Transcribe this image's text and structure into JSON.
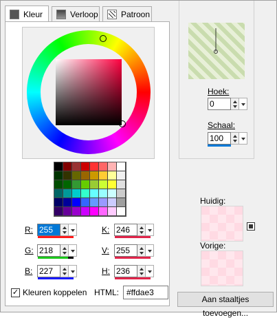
{
  "tabs": [
    {
      "label": "Kleur",
      "active": true
    },
    {
      "label": "Verloop",
      "active": false
    },
    {
      "label": "Patroon",
      "active": false
    }
  ],
  "color": {
    "r": "255",
    "g": "218",
    "b": "227",
    "k": "246",
    "v": "255",
    "h": "236",
    "html": "#ffdae3"
  },
  "labels": {
    "r": "R:",
    "g": "G:",
    "b": "B:",
    "k": "K:",
    "v": "V:",
    "h": "H:",
    "html": "HTML:",
    "link": "Kleuren koppelen",
    "hoek": "Hoek:",
    "schaal": "Schaal:",
    "huidig": "Huidig:",
    "vorige": "Vorige:",
    "button": "Aan staaltjes toevoegen..."
  },
  "pattern": {
    "hoek": "0",
    "schaal": "100"
  },
  "link_checked": true,
  "palette": [
    [
      "#000000",
      "#800000",
      "#993333",
      "#cc0000",
      "#ff3333",
      "#ff6666",
      "#ffb3b3",
      "#ffffff"
    ],
    [
      "#003300",
      "#333300",
      "#666600",
      "#996600",
      "#cc9900",
      "#ffcc33",
      "#ffff99",
      "#f0f0f0"
    ],
    [
      "#004d00",
      "#006600",
      "#339933",
      "#66cc00",
      "#99cc33",
      "#ccff33",
      "#ffff33",
      "#e0e0e0"
    ],
    [
      "#006666",
      "#009999",
      "#00cccc",
      "#33ffcc",
      "#66ffff",
      "#99ffff",
      "#ccffff",
      "#cccccc"
    ],
    [
      "#000066",
      "#000099",
      "#0000ff",
      "#3366ff",
      "#6699ff",
      "#9999ff",
      "#ccccff",
      "#a0a0a0"
    ],
    [
      "#330066",
      "#660099",
      "#9900cc",
      "#cc00ff",
      "#ff00ff",
      "#ff66ff",
      "#ffccff",
      "#ffffff"
    ]
  ]
}
